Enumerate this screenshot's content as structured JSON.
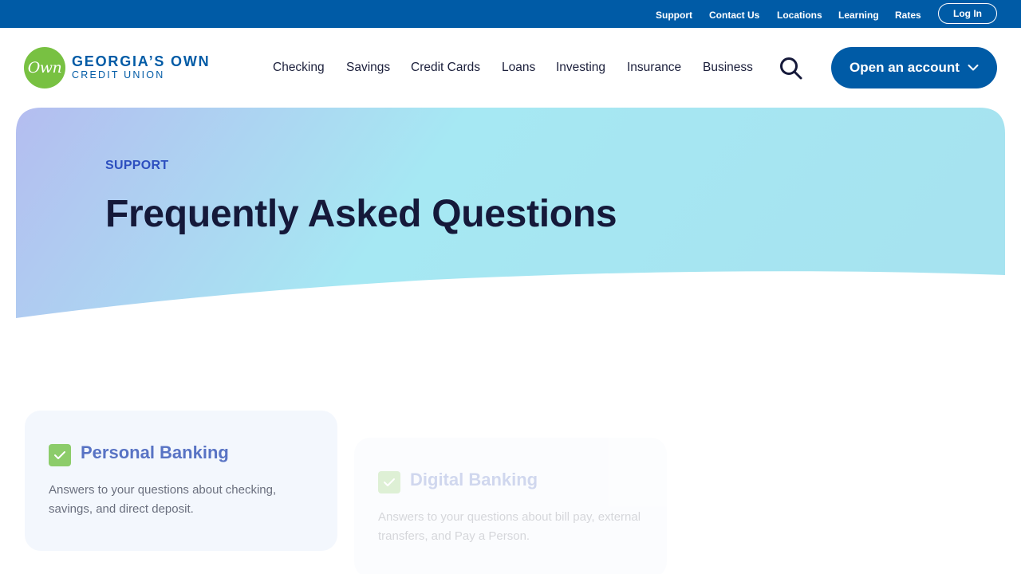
{
  "utility_bar": {
    "links": [
      "Support",
      "Contact Us",
      "Locations",
      "Learning",
      "Rates"
    ],
    "login_label": "Log In",
    "background": "#005ba6"
  },
  "header": {
    "logo": {
      "mark": "Own",
      "line1": "GEORGIA’S OWN",
      "line2": "CREDIT UNION"
    },
    "nav": [
      "Checking",
      "Savings",
      "Credit Cards",
      "Loans",
      "Investing",
      "Insurance",
      "Business"
    ],
    "search_icon": "search-icon",
    "cta_label": "Open an account",
    "cta_icon": "chevron-down-icon"
  },
  "hero": {
    "eyebrow": "SUPPORT",
    "title": "Frequently Asked Questions",
    "gradient_start": "#b4bdf0",
    "gradient_end": "#a6e8f3"
  },
  "cards": [
    {
      "title": "Personal Banking",
      "description": "Answers to your questions about checking, savings, and direct deposit.",
      "icon": "check-icon"
    },
    {
      "title": "Digital Banking",
      "description": "Answers to your questions about bill pay, external transfers, and Pay a Person.",
      "icon": "check-icon"
    }
  ],
  "colors": {
    "brand_blue": "#005ba6",
    "brand_green": "#78c142",
    "card_title": "#5873c4"
  }
}
